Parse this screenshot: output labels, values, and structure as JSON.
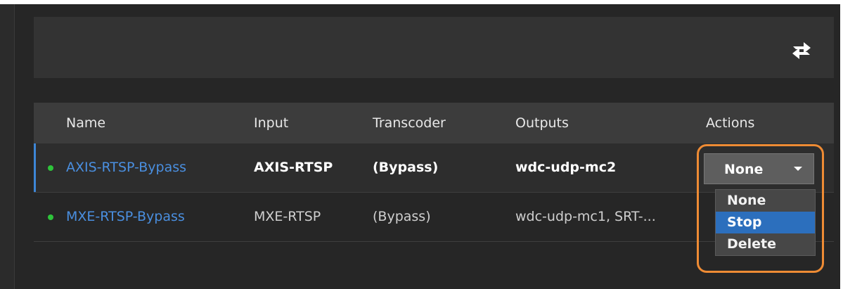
{
  "table": {
    "headers": [
      "Name",
      "Input",
      "Transcoder",
      "Outputs",
      "Actions"
    ],
    "rows": [
      {
        "status": "running",
        "name": "AXIS-RTSP-Bypass",
        "input": "AXIS-RTSP",
        "transcoder": "(Bypass)",
        "outputs": "wdc-udp-mc2"
      },
      {
        "status": "running",
        "name": "MXE-RTSP-Bypass",
        "input": "MXE-RTSP",
        "transcoder": "(Bypass)",
        "outputs": "wdc-udp-mc1, SRT-..."
      }
    ]
  },
  "actions_select": {
    "selected": "None",
    "options": [
      "None",
      "Stop",
      "Delete"
    ],
    "highlighted": "Stop"
  },
  "toolbar": {
    "refresh_icon": "refresh-arrows-icon"
  },
  "colors": {
    "background": "#262626",
    "link": "#4a8fe0",
    "status_green": "#2ec43b",
    "menu_highlight": "#2c6fbd",
    "callout_ring": "#ee8b34"
  }
}
